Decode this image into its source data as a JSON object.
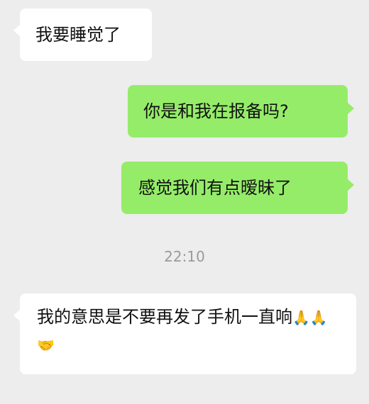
{
  "conversation": {
    "messages": [
      {
        "side": "left",
        "text": "我要睡觉了"
      },
      {
        "side": "right",
        "text": "你是和我在报备吗?"
      },
      {
        "side": "right",
        "text": "感觉我们有点暧昧了"
      },
      {
        "side": "left",
        "text": "我的意思是不要再发了手机一直响",
        "emoji": [
          "🙏",
          "🙏",
          "🤝"
        ]
      }
    ],
    "timestamp": "22:10"
  },
  "colors": {
    "background": "#ededed",
    "incoming_bubble": "#ffffff",
    "outgoing_bubble": "#95ec69",
    "timestamp_text": "#9a9a9a"
  },
  "icons": [
    "folded-hands-emoji",
    "folded-hands-emoji",
    "handshake-emoji"
  ]
}
